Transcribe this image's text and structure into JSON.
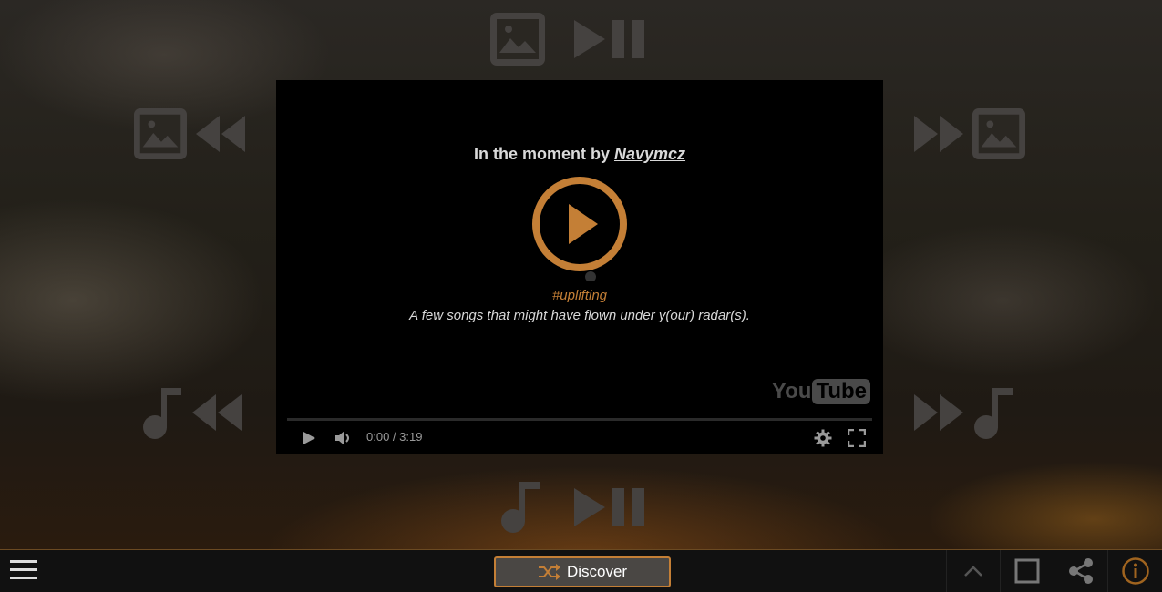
{
  "player": {
    "title_prefix": "In the moment by ",
    "author": "Navymcz",
    "tag": "#uplifting",
    "description": "A few songs that might have flown under y(our) radar(s).",
    "time": "0:00 / 3:19",
    "youtube_logo_you": "You",
    "youtube_logo_tube": "Tube"
  },
  "bottom_bar": {
    "discover_label": "Discover",
    "accent_color": "#c47f36"
  },
  "icons": {
    "top_controls": [
      "image-icon",
      "play-pause-icon"
    ],
    "left_upper": [
      "image-icon",
      "rewind-icon"
    ],
    "right_upper": [
      "fast-forward-icon",
      "image-icon"
    ],
    "left_lower": [
      "music-note-icon",
      "rewind-icon"
    ],
    "right_lower": [
      "fast-forward-icon",
      "music-note-icon"
    ],
    "bottom_controls": [
      "music-note-icon",
      "play-pause-icon"
    ],
    "bottom_right": [
      "chevron-up-icon",
      "square-icon",
      "share-icon",
      "info-icon"
    ]
  }
}
